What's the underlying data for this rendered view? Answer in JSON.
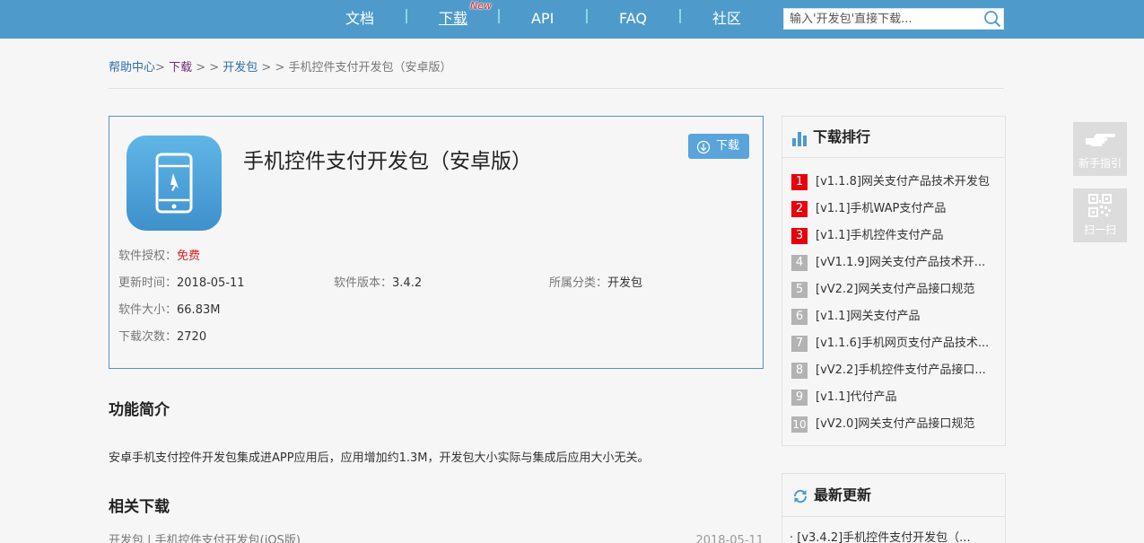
{
  "nav": {
    "items": [
      {
        "label": "文档"
      },
      {
        "label": "下载"
      },
      {
        "label": "API"
      },
      {
        "label": "FAQ"
      },
      {
        "label": "社区"
      }
    ],
    "new_badge": "New",
    "search_placeholder": "输入'开发包'直接下载..."
  },
  "breadcrumb": {
    "home": "帮助中心",
    "sep1": ">",
    "download": "下载",
    "sep2": " > > ",
    "devpack": "开发包",
    "sep3": " > > ",
    "current": "手机控件支付开发包（安卓版）"
  },
  "product": {
    "title": "手机控件支付开发包（安卓版）",
    "download_label": "下载",
    "meta": {
      "license_label": "软件授权：",
      "license_value": "免费",
      "updated_label": "更新时间：",
      "updated_value": "2018-05-11",
      "version_label": "软件版本：",
      "version_value": "3.4.2",
      "category_label": "所属分类：",
      "category_value": "开发包",
      "size_label": "软件大小：",
      "size_value": "66.83M",
      "downloads_label": "下载次数：",
      "downloads_value": "2720"
    }
  },
  "intro": {
    "title": "功能简介",
    "text": "安卓手机支付控件开发包集成进APP应用后，应用增加约1.3M，开发包大小实际与集成后应用大小无关。"
  },
  "related": {
    "title": "相关下载",
    "items": [
      {
        "text": "开发包 | 手机控件支付开发包(iOS版)",
        "date": "2018-05-11"
      }
    ]
  },
  "ranking": {
    "title": "下载排行",
    "items": [
      {
        "num": "1",
        "text": "[v1.1.8]网关支付产品技术开发包"
      },
      {
        "num": "2",
        "text": "[v1.1]手机WAP支付产品"
      },
      {
        "num": "3",
        "text": "[v1.1]手机控件支付产品"
      },
      {
        "num": "4",
        "text": "[vV1.1.9]网关支付产品技术开..."
      },
      {
        "num": "5",
        "text": "[vV2.2]网关支付产品接口规范"
      },
      {
        "num": "6",
        "text": "[v1.1]网关支付产品"
      },
      {
        "num": "7",
        "text": "[v1.1.6]手机网页支付产品技术..."
      },
      {
        "num": "8",
        "text": "[vV2.2]手机控件支付产品接口..."
      },
      {
        "num": "9",
        "text": "[v1.1]代付产品"
      },
      {
        "num": "10",
        "text": "[vV2.0]网关支付产品接口规范"
      }
    ]
  },
  "latest": {
    "title": "最新更新",
    "items": [
      {
        "text": "· [v3.4.2]手机控件支付开发包（..."
      }
    ]
  },
  "float": {
    "guide_label": "新手指引",
    "scan_label": "扫一扫"
  },
  "colors": {
    "nav_bg": "#4e9bcb",
    "accent_blue": "#5aa4dc",
    "rank_top": "#e8000b",
    "rank_rest": "#b3b3b3",
    "free_red": "#d62222"
  }
}
